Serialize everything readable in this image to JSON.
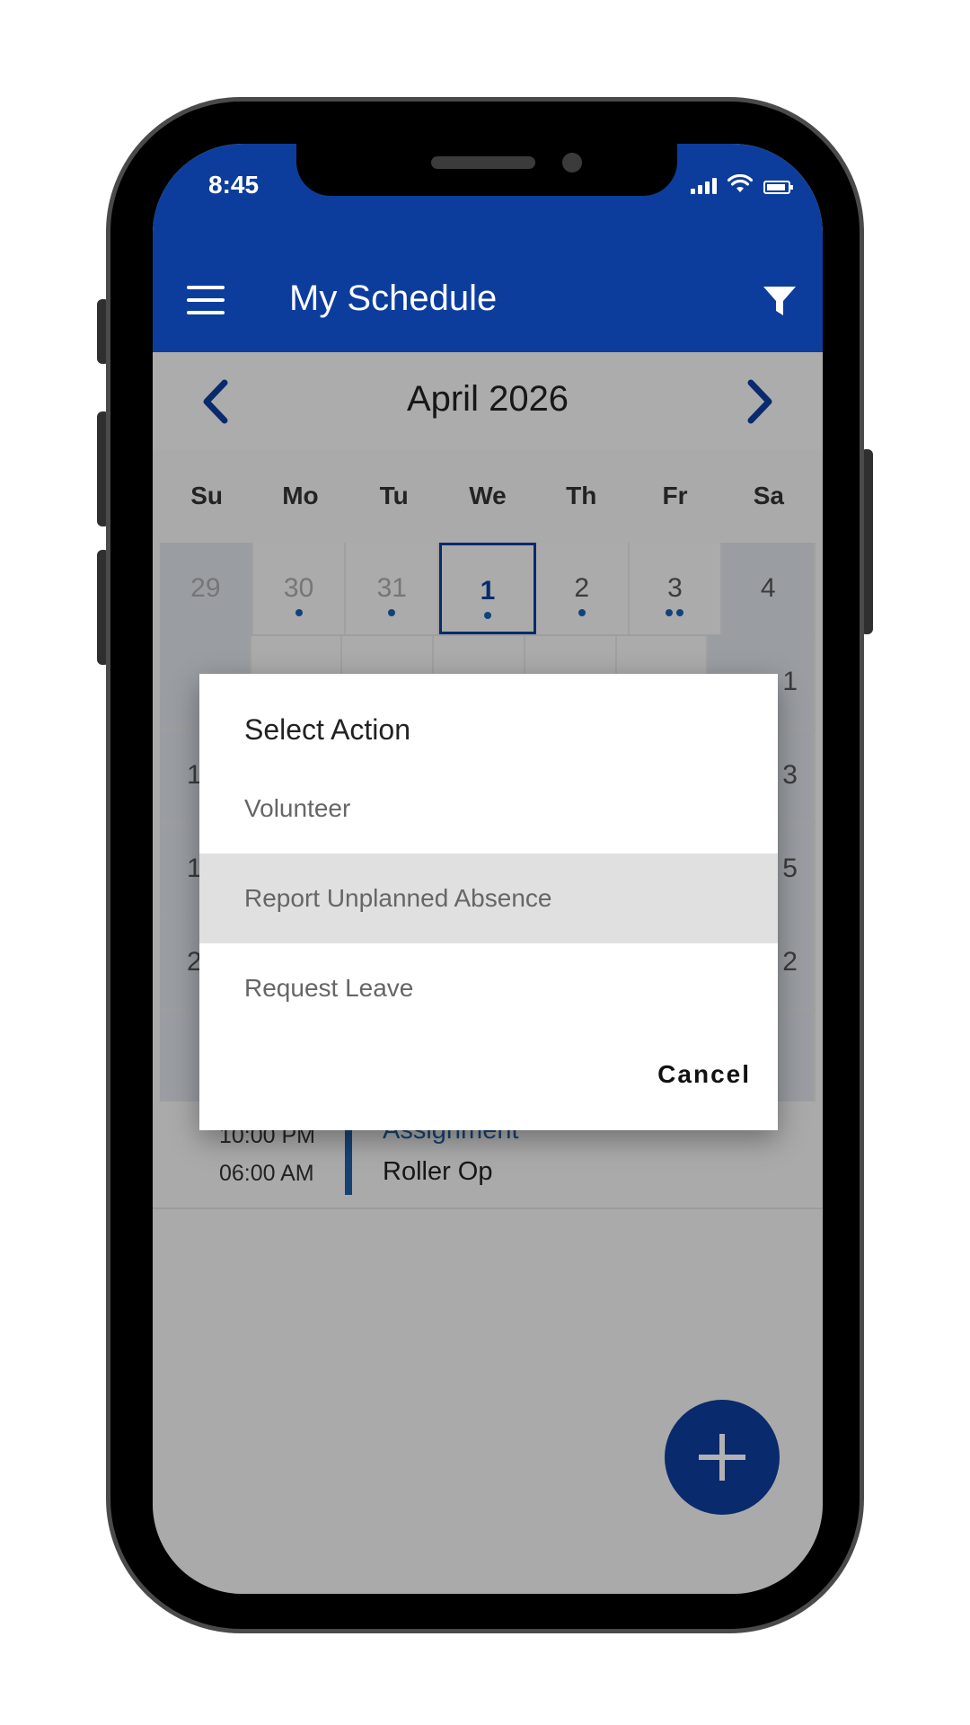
{
  "status_bar": {
    "time": "8:45"
  },
  "app_bar": {
    "title": "My Schedule"
  },
  "calendar": {
    "month": "April 2026",
    "weekdays": [
      "Su",
      "Mo",
      "Tu",
      "We",
      "Th",
      "Fr",
      "Sa"
    ],
    "week1": [
      "29",
      "30",
      "31",
      "1",
      "2",
      "3",
      "4"
    ],
    "peek": {
      "row2_sa": "1",
      "row3_su": "1",
      "row3_sa": "3",
      "row4_su": "1",
      "row4_sa": "5",
      "row5_su": "2",
      "row5_sa": "2"
    }
  },
  "shift": {
    "start": "10:00 PM",
    "end": "06:00 AM",
    "type": "Assignment",
    "role": "Roller Op"
  },
  "dialog": {
    "title": "Select Action",
    "options": [
      "Volunteer",
      "Report Unplanned Absence",
      "Request Leave"
    ],
    "cancel_label": "Cancel"
  },
  "colors": {
    "primary": "#0d3d9c",
    "accent": "#1f5fa6"
  },
  "icons": {
    "menu": "hamburger-menu-icon",
    "filter": "filter-icon",
    "prev": "chevron-left-icon",
    "next": "chevron-right-icon",
    "add": "plus-icon"
  }
}
